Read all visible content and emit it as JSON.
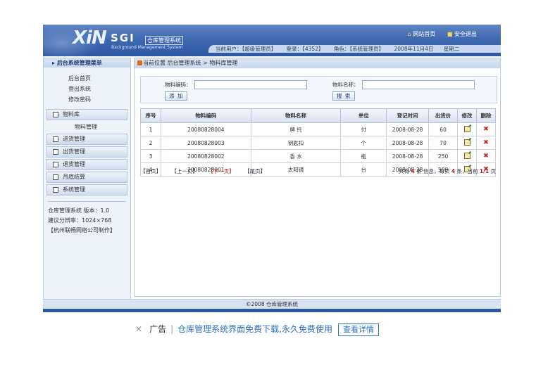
{
  "header": {
    "logo_big": "XiN",
    "logo_sub": "SGI",
    "logo_cn": "仓库管理系统",
    "logo_en": "Background Management System",
    "site_home": "网站首页",
    "logout": "安全退出",
    "current_user": "当前用户：【超级管理员】",
    "login": "登录：【4352】",
    "role": "角色：【系统管理员】",
    "date": "2008年11月4日",
    "weekday": "星期二"
  },
  "sidebar": {
    "title": "后台系统管理菜单",
    "quick_links": [
      "后台首页",
      "登出系统",
      "修改密码"
    ],
    "menus": [
      {
        "label": "物料库",
        "children": [
          "物料管理"
        ]
      },
      {
        "label": "进货管理",
        "children": []
      },
      {
        "label": "出货管理",
        "children": []
      },
      {
        "label": "退货管理",
        "children": []
      },
      {
        "label": "月底结算",
        "children": []
      },
      {
        "label": "系统管理",
        "children": []
      }
    ],
    "info": [
      "仓库管理系统 版本：1.0",
      "建议分辨率：1024×768",
      "【杭州联畅网络公司制作】"
    ]
  },
  "breadcrumb": "当前位置 后台管理系统 > 物料库管理",
  "search": {
    "code_label": "物料编码：",
    "name_label": "物料名称：",
    "add_button": "添 加",
    "search_button": "搜 索"
  },
  "table": {
    "headers": [
      "序号",
      "物料编码",
      "物料名称",
      "单位",
      "登记时间",
      "出货价",
      "修改",
      "删除"
    ],
    "rows": [
      [
        "1",
        "20080828004",
        "牌 托",
        "付",
        "2008-08-28",
        "60"
      ],
      [
        "2",
        "20080828003",
        "钥匙扣",
        "个",
        "2008-08-28",
        "70"
      ],
      [
        "3",
        "20080828002",
        "香 水",
        "瓶",
        "2008-08-28",
        "250"
      ],
      [
        "4",
        "20080828001",
        "太阳镜",
        "台",
        "2008-08-28",
        "500"
      ]
    ]
  },
  "pager": {
    "first": "【首页】",
    "prev": "【上一页】",
    "next": "【下一页】",
    "last": "【尾页】",
    "summary_prefix": "共有",
    "total": "4",
    "summary_mid": "条 信息，每页",
    "per_page": "4",
    "summary_mid2": "条，当前",
    "page": "1/1",
    "summary_suffix": "页"
  },
  "footer": "©2008 仓库管理系统",
  "ad": {
    "label": "广告",
    "text": "仓库管理系统界面免费下载,永久免费使用",
    "detail": "查看详情"
  }
}
